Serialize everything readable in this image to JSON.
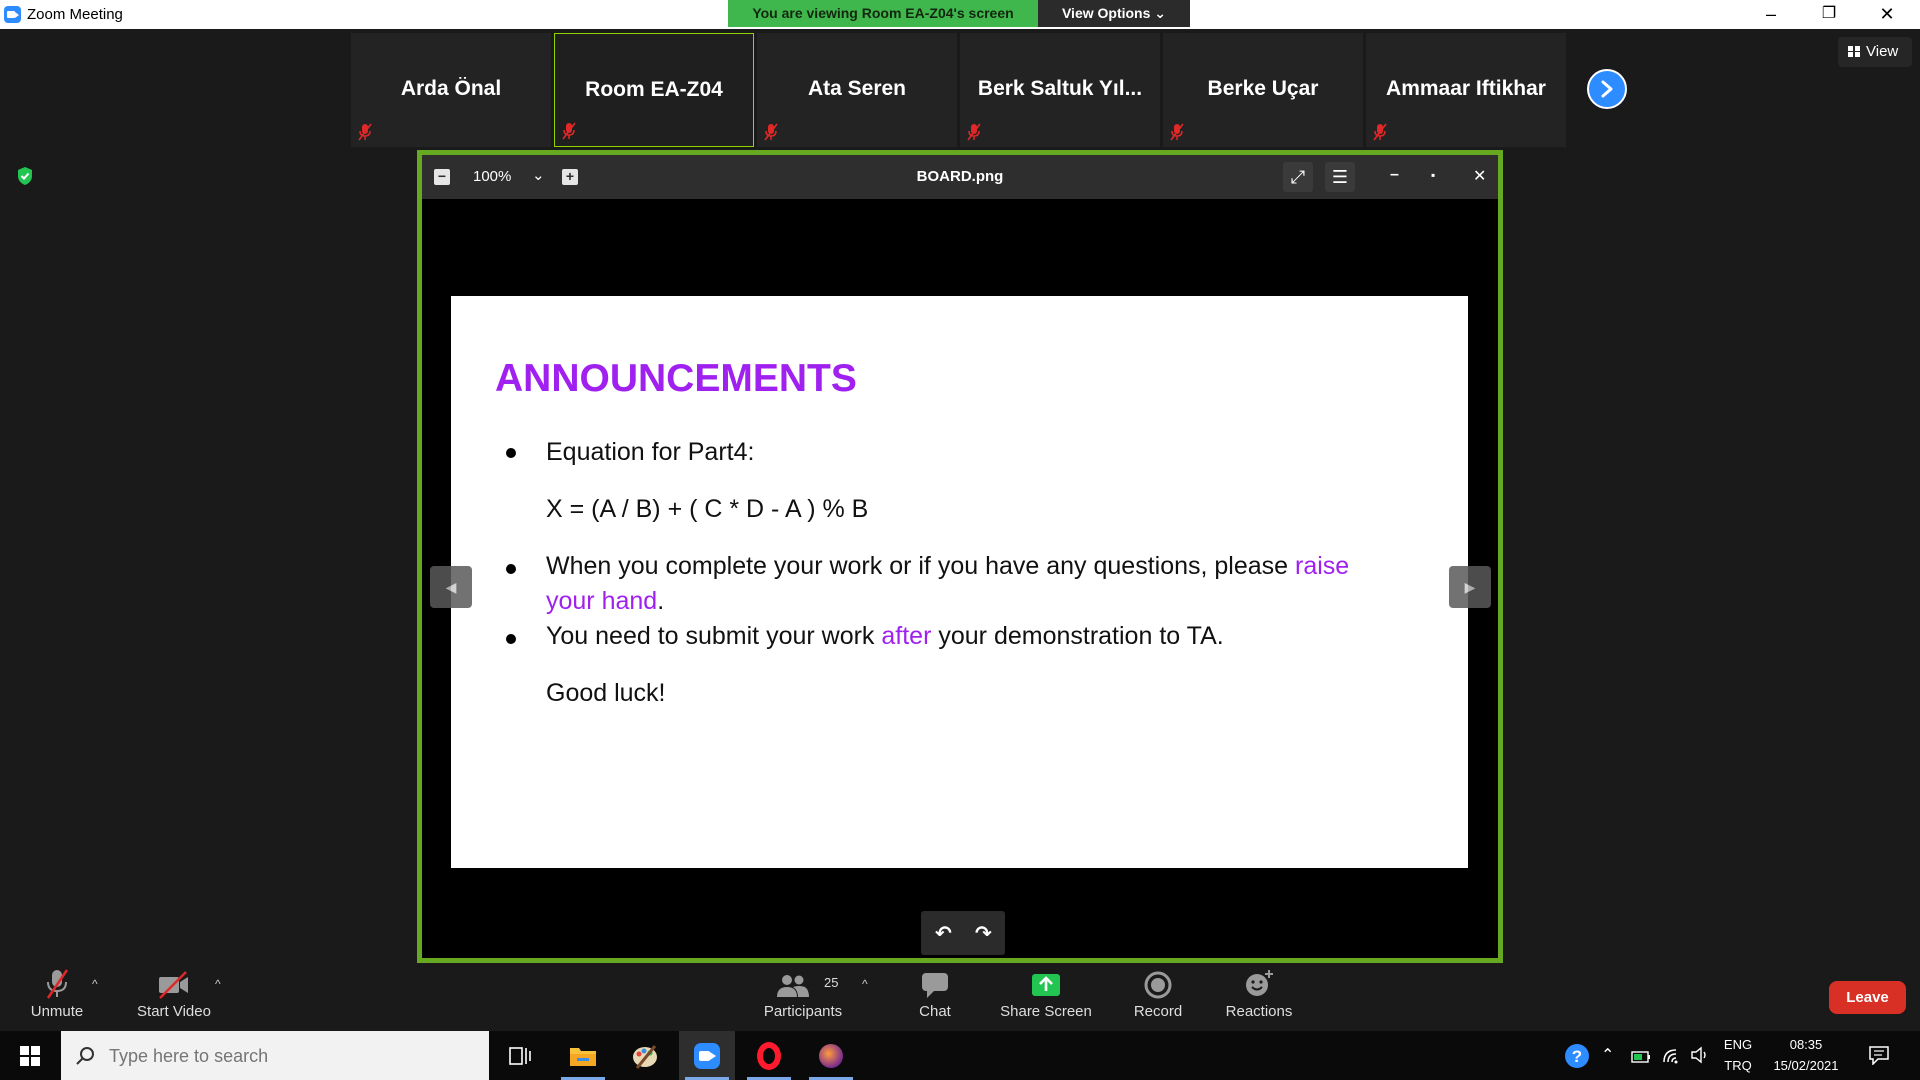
{
  "window": {
    "title": "Zoom Meeting",
    "minimize": "–",
    "restore": "❐",
    "close": "✕"
  },
  "banner": {
    "viewing": "You are viewing Room EA-Z04's screen",
    "view_options": "View Options ⌄"
  },
  "participants": [
    {
      "name": "Arda Önal",
      "active": false
    },
    {
      "name": "Room EA-Z04",
      "active": true
    },
    {
      "name": "Ata Seren",
      "active": false
    },
    {
      "name": "Berk Saltuk Yıl...",
      "active": false
    },
    {
      "name": "Berke Uçar",
      "active": false
    },
    {
      "name": "Ammaar Iftikhar",
      "active": false
    }
  ],
  "view_button": "View",
  "viewer": {
    "zoom_out": "−",
    "zoom_level": "100%",
    "zoom_chevron": "⌄",
    "zoom_in": "+",
    "filename": "BOARD.png",
    "expand": "⤢",
    "menu": "☰",
    "minimize": "–",
    "maximize": "▪",
    "close": "✕",
    "prev": "◀",
    "next": "▶",
    "rotate_left": "↶",
    "rotate_right": "↷"
  },
  "slide": {
    "heading": "ANNOUNCEMENTS",
    "eq_label": "Equation for Part4:",
    "equation": "X = (A / B) + ( C * D - A ) % B",
    "b2_pre": "When you complete your work or if you have any questions, please ",
    "b2_hl1": "raise",
    "b2_hl2": "your hand",
    "b2_post": ".",
    "b3_pre": "You need to submit your work ",
    "b3_hl": "after",
    "b3_post": " your demonstration to TA.",
    "closing": "Good luck!",
    "accent_color": "#a020f0"
  },
  "toolbar": {
    "unmute": "Unmute",
    "start_video": "Start Video",
    "participants": "Participants",
    "participant_count": "25",
    "chat": "Chat",
    "share_screen": "Share Screen",
    "record": "Record",
    "reactions": "Reactions",
    "leave": "Leave",
    "caret": "^"
  },
  "taskbar": {
    "search_placeholder": "Type here to search",
    "lang_top": "ENG",
    "lang_bottom": "TRQ",
    "time": "08:35",
    "date": "15/02/2021"
  },
  "colors": {
    "green_banner": "#3fb74d",
    "share_border": "#66a81f",
    "zoom_blue": "#2d8cff",
    "leave_red": "#d93025"
  }
}
